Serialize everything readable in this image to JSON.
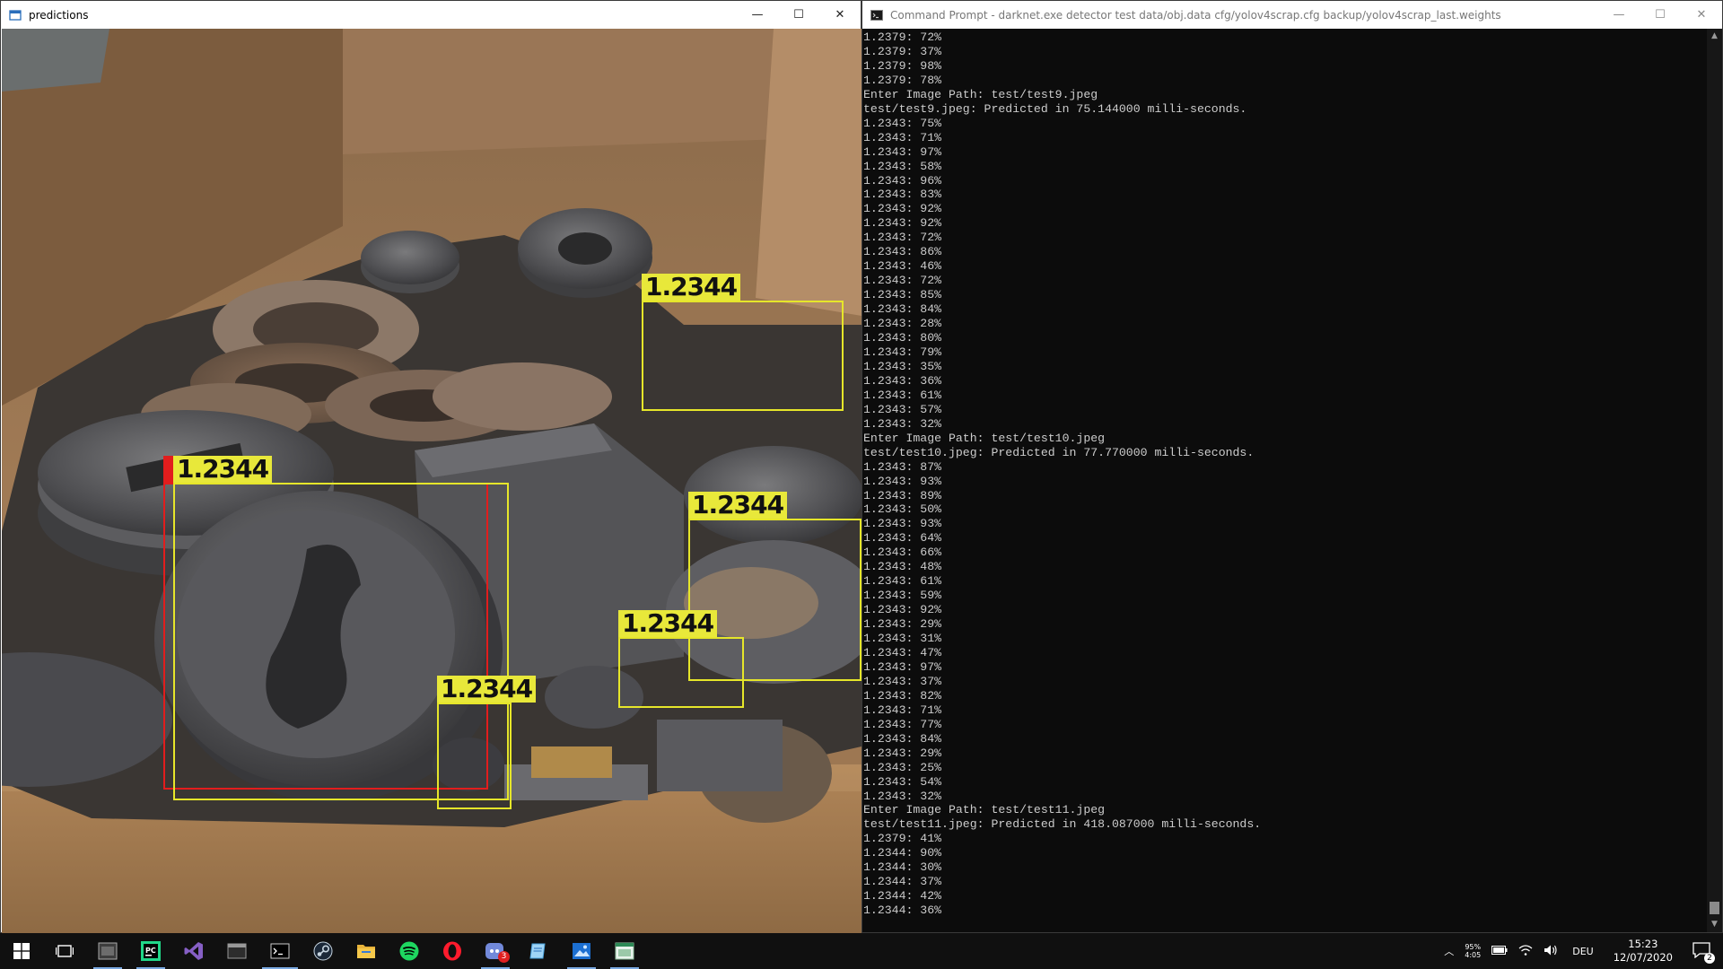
{
  "predictions_window": {
    "title": "predictions",
    "controls": {
      "minimize": "—",
      "maximize": "☐",
      "close": "✕"
    },
    "detections": [
      {
        "label": "1.2344"
      },
      {
        "label": "1.2344"
      },
      {
        "label": "1.2344"
      },
      {
        "label": "1.2344"
      },
      {
        "label": "1.2344"
      }
    ]
  },
  "cmd_window": {
    "title": "Command Prompt - darknet.exe  detector test data/obj.data cfg/yolov4scrap.cfg backup/yolov4scrap_last.weights",
    "controls": {
      "minimize": "—",
      "maximize": "☐",
      "close": "✕"
    },
    "lines": [
      "1.2379: 72%",
      "1.2379: 37%",
      "1.2379: 98%",
      "1.2379: 78%",
      "Enter Image Path: test/test9.jpeg",
      "test/test9.jpeg: Predicted in 75.144000 milli-seconds.",
      "1.2343: 75%",
      "1.2343: 71%",
      "1.2343: 97%",
      "1.2343: 58%",
      "1.2343: 96%",
      "1.2343: 83%",
      "1.2343: 92%",
      "1.2343: 92%",
      "1.2343: 72%",
      "1.2343: 86%",
      "1.2343: 46%",
      "1.2343: 72%",
      "1.2343: 85%",
      "1.2343: 84%",
      "1.2343: 28%",
      "1.2343: 80%",
      "1.2343: 79%",
      "1.2343: 35%",
      "1.2343: 36%",
      "1.2343: 61%",
      "1.2343: 57%",
      "1.2343: 32%",
      "Enter Image Path: test/test10.jpeg",
      "test/test10.jpeg: Predicted in 77.770000 milli-seconds.",
      "1.2343: 87%",
      "1.2343: 93%",
      "1.2343: 89%",
      "1.2343: 50%",
      "1.2343: 93%",
      "1.2343: 64%",
      "1.2343: 66%",
      "1.2343: 48%",
      "1.2343: 61%",
      "1.2343: 59%",
      "1.2343: 92%",
      "1.2343: 29%",
      "1.2343: 31%",
      "1.2343: 47%",
      "1.2343: 97%",
      "1.2343: 37%",
      "1.2343: 82%",
      "1.2343: 71%",
      "1.2343: 77%",
      "1.2343: 84%",
      "1.2343: 29%",
      "1.2343: 25%",
      "1.2343: 54%",
      "1.2343: 32%",
      "Enter Image Path: test/test11.jpeg",
      "test/test11.jpeg: Predicted in 418.087000 milli-seconds.",
      "1.2379: 41%",
      "1.2344: 90%",
      "1.2344: 30%",
      "1.2344: 37%",
      "1.2344: 42%",
      "1.2344: 36%"
    ]
  },
  "taskbar": {
    "items": [
      {
        "icon": "windows-start-icon"
      },
      {
        "icon": "task-view-icon"
      },
      {
        "icon": "app-window-icon"
      },
      {
        "icon": "pycharm-icon"
      },
      {
        "icon": "visual-studio-icon"
      },
      {
        "icon": "file-window-icon"
      },
      {
        "icon": "terminal-icon"
      },
      {
        "icon": "steam-icon"
      },
      {
        "icon": "file-explorer-icon"
      },
      {
        "icon": "spotify-icon"
      },
      {
        "icon": "opera-icon"
      },
      {
        "icon": "discord-icon",
        "badge": "3"
      },
      {
        "icon": "notepad-icon"
      },
      {
        "icon": "photos-icon"
      },
      {
        "icon": "predictions-window-icon"
      }
    ],
    "tray": {
      "battery_percent": "95%",
      "battery_time": "4:05",
      "language": "DEU",
      "time": "15:23",
      "date": "12/07/2020",
      "notifications": "2"
    }
  },
  "colors": {
    "box_yellow": "#e8e83a",
    "box_red": "#e21d1d",
    "console_bg": "#0c0c0c",
    "console_text": "#cccccc",
    "taskbar_bg": "#101010"
  }
}
